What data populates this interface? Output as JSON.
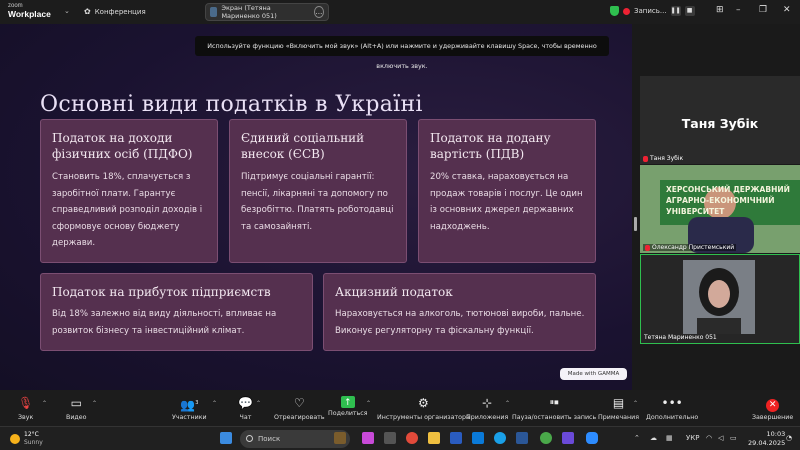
{
  "app": {
    "logo_line1": "zoom",
    "logo_line2": "Workplace",
    "meeting_label": "Конференция",
    "share_label": "Экран (Тетяна Мариненко 051)",
    "recording_label": "Запись..."
  },
  "notice": "Используйте функцию «Включить мой звук» (Alt+A) или нажмите и удерживайте клавишу Space, чтобы временно включить звук.",
  "slide": {
    "title": "Основні види податків в Україні",
    "cards": [
      {
        "title": "Податок на доходи фізичних осіб (ПДФО)",
        "body": "Становить 18%, сплачується з заробітної плати. Гарантує справедливий розподіл доходів і сформовує основу бюджету держави."
      },
      {
        "title": "Єдиний соціальний внесок (ЄСВ)",
        "body": "Підтримує соціальні гарантії: пенсії, лікарняні та допомогу по безробіттю. Платять роботодавці та самозайняті."
      },
      {
        "title": "Податок на додану вартість (ПДВ)",
        "body": "20% ставка, нараховується на продаж товарів і послуг. Це один із основних джерел державних надходжень."
      },
      {
        "title": "Податок на прибуток підприємств",
        "body": "Від 18% залежно від виду діяльності, впливає на розвиток бізнесу та інвестиційний клімат."
      },
      {
        "title": "Акцизний податок",
        "body": "Нараховується на алкоголь, тютюнові вироби, пальне. Виконує регуляторну та фіскальну функції."
      }
    ],
    "made_with": "Made with GAMMA"
  },
  "participants": [
    {
      "big_name": "Таня Зубік",
      "name": "Таня Зубік",
      "muted": true
    },
    {
      "name": "Олександр Пристемський",
      "muted": true,
      "banner_text": "ХЕРСОНСЬКИЙ ДЕРЖАВНИЙ АГРАРНО-ЕКОНОМІЧНИЙ УНІВЕРСИТЕТ"
    },
    {
      "name": "Тетяна Мариненко 051",
      "muted": false
    }
  ],
  "controls": {
    "audio": "Звук",
    "video": "Видео",
    "participants": "Участники",
    "participants_count": "3",
    "chat": "Чат",
    "react": "Отреагировать",
    "share": "Поделиться",
    "host_tools": "Инструменты организатора",
    "apps": "Приложения",
    "pause_rec": "Пауза/остановить запись",
    "notes": "Примечания",
    "more": "Дополнительно",
    "end": "Завершение"
  },
  "taskbar": {
    "temp": "12°C",
    "weather": "Sunny",
    "search": "Поиск",
    "lang": "УКР",
    "time": "10:03",
    "date": "29.04.2025"
  },
  "colors": {
    "slide_bg": "#1a1230",
    "card_bg": "#55304f",
    "end_red": "#e22222",
    "share_green": "#2fbf4f"
  }
}
